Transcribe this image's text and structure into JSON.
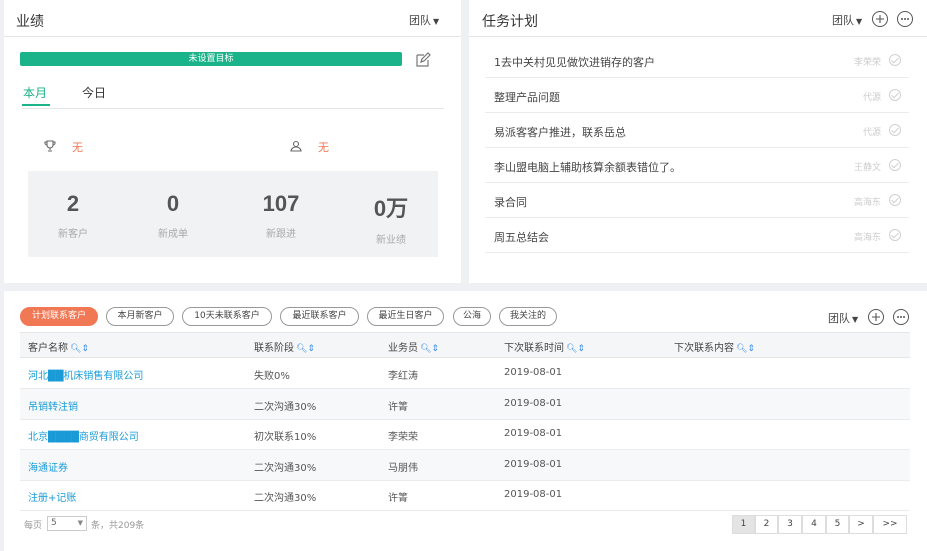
{
  "performance": {
    "title": "业绩",
    "team_label": "团队",
    "goal_banner": "未设置目标",
    "tabs": [
      {
        "label": "本月"
      },
      {
        "label": "今日"
      }
    ],
    "ranks": [
      {
        "icon": "trophy-icon",
        "value": "无"
      },
      {
        "icon": "team-icon",
        "value": "无"
      }
    ],
    "metrics": [
      {
        "value": "2",
        "label": "新客户"
      },
      {
        "value": "0",
        "label": "新成单"
      },
      {
        "value": "107",
        "label": "新跟进"
      },
      {
        "value": "0万",
        "label": "新业绩"
      }
    ],
    "accent": "#1bb38a"
  },
  "tasks": {
    "title": "任务计划",
    "team_label": "团队",
    "items": [
      {
        "text": "1去中关村见见做饮进销存的客户",
        "owner": "李荣荣"
      },
      {
        "text": "整理产品问题",
        "owner": "代源"
      },
      {
        "text": "易派客客户推进，联系岳总",
        "owner": "代源"
      },
      {
        "text": "李山盟电脑上辅助核算余额表错位了。",
        "owner": "王静文"
      },
      {
        "text": "录合同",
        "owner": "高海东"
      },
      {
        "text": "周五总结会",
        "owner": "高海东"
      }
    ]
  },
  "customers": {
    "filters": [
      "计划联系客户",
      "本月新客户",
      "10天未联系客户",
      "最近联系客户",
      "最近生日客户",
      "公海",
      "我关注的"
    ],
    "active_filter_color": "#f07855",
    "team_label": "团队",
    "columns": [
      "客户名称",
      "联系阶段",
      "业务员",
      "下次联系时间",
      "下次联系内容"
    ],
    "rows": [
      {
        "name": "河北██机床销售有限公司",
        "stage": "失败0%",
        "rep": "李红涛",
        "next_time": "2019-08-01",
        "next_content": ""
      },
      {
        "name": "吊销转注销",
        "stage": "二次沟通30%",
        "rep": "许箐",
        "next_time": "2019-08-01",
        "next_content": ""
      },
      {
        "name": "北京████商贸有限公司",
        "stage": "初次联系10%",
        "rep": "李荣荣",
        "next_time": "2019-08-01",
        "next_content": ""
      },
      {
        "name": "海通证券",
        "stage": "二次沟通30%",
        "rep": "马朋伟",
        "next_time": "2019-08-01",
        "next_content": ""
      },
      {
        "name": "注册+记账",
        "stage": "二次沟通30%",
        "rep": "许箐",
        "next_time": "2019-08-01",
        "next_content": ""
      }
    ],
    "pagination": {
      "per_page_prefix": "每页",
      "per_page_value": "5",
      "summary": "条，共209条",
      "pages": [
        "1",
        "2",
        "3",
        "4",
        "5",
        ">",
        ">>"
      ],
      "current": "1"
    },
    "link_color": "#1a9bd7"
  }
}
